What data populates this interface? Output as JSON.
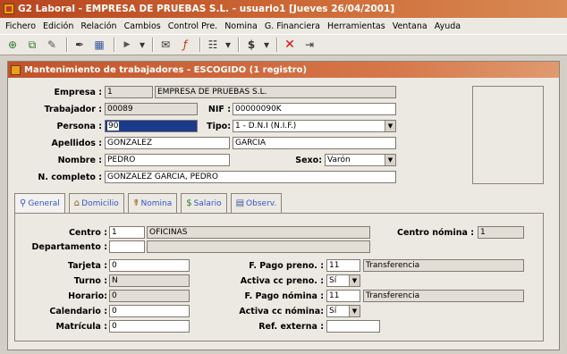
{
  "app": {
    "title": "G2 Laboral - EMPRESA DE PRUEBAS S.L. - usuario1 [Jueves 26/04/2001]"
  },
  "menu": [
    "Fichero",
    "Edición",
    "Relación",
    "Cambios",
    "Control Pre.",
    "Nomina",
    "G. Financiera",
    "Herramientas",
    "Ventana",
    "Ayuda"
  ],
  "toolbar": {
    "icons": [
      "new-record-icon",
      "copy-record-icon",
      "edit-pencil-icon",
      "pen-tool-icon",
      "image-icon",
      "play-icon",
      "dropdown-icon",
      "report-icon",
      "function-icon",
      "grid-icon",
      "currency-icon",
      "close-x-icon",
      "export-icon"
    ],
    "glyphs": {
      "new": "⊕",
      "copy": "⧉",
      "edit": "✎",
      "pen": "✒",
      "image": "▦",
      "play": "▶",
      "drop": "▾",
      "report": "✉",
      "func": "ƒ",
      "grid": "☷",
      "currency": "$",
      "close": "✕",
      "export": "⇥"
    }
  },
  "window": {
    "title": "Mantenimiento de trabajadores - ESCOGIDO (1 registro)"
  },
  "form": {
    "empresa_label": "Empresa :",
    "empresa_code": "1",
    "empresa_name": "EMPRESA DE PRUEBAS S.L.",
    "trabajador_label": "Trabajador :",
    "trabajador_value": "00089",
    "nif_label": "NIF :",
    "nif_value": "00000090K",
    "persona_label": "Persona :",
    "persona_value": "90",
    "tipo_label": "Tipo:",
    "tipo_value": "1 - D.N.I (N.I.F.)",
    "apellidos_label": "Apellidos :",
    "apellido1": "GONZALEZ",
    "apellido2": "GARCIA",
    "nombre_label": "Nombre :",
    "nombre_value": "PEDRO",
    "sexo_label": "Sexo:",
    "sexo_value": "Varón",
    "completo_label": "N. completo :",
    "completo_value": "GONZALEZ GARCIA, PEDRO"
  },
  "tabs": [
    {
      "label": "General",
      "icon": "⚲"
    },
    {
      "label": "Domicilio",
      "icon": "⌂"
    },
    {
      "label": "Nomina",
      "icon": "☤"
    },
    {
      "label": "Salario",
      "icon": "$"
    },
    {
      "label": "Observ.",
      "icon": "▤"
    }
  ],
  "general": {
    "centro_label": "Centro :",
    "centro_code": "1",
    "centro_name": "OFICINAS",
    "centro_nomina_label": "Centro nómina :",
    "centro_nomina_value": "1",
    "departamento_label": "Departamento :",
    "departamento_code": "",
    "departamento_name": "",
    "tarjeta_label": "Tarjeta :",
    "tarjeta_value": "0",
    "turno_label": "Turno :",
    "turno_value": "N",
    "horario_label": "Horario:",
    "horario_value": "0",
    "calendario_label": "Calendario :",
    "calendario_value": "0",
    "matricula_label": "Matrícula :",
    "matricula_value": "0",
    "pago_preno_label": "F. Pago preno. :",
    "pago_preno_code": "11",
    "pago_preno_name": "Transferencia",
    "activa_preno_label": "Activa cc preno. :",
    "activa_preno_value": "Sí",
    "pago_nomina_label": "F. Pago nómina :",
    "pago_nomina_code": "11",
    "pago_nomina_name": "Transferencia",
    "activa_nomina_label": "Activa cc nómina:",
    "activa_nomina_value": "Sí",
    "ref_externa_label": "Ref. externa :",
    "ref_externa_value": ""
  }
}
